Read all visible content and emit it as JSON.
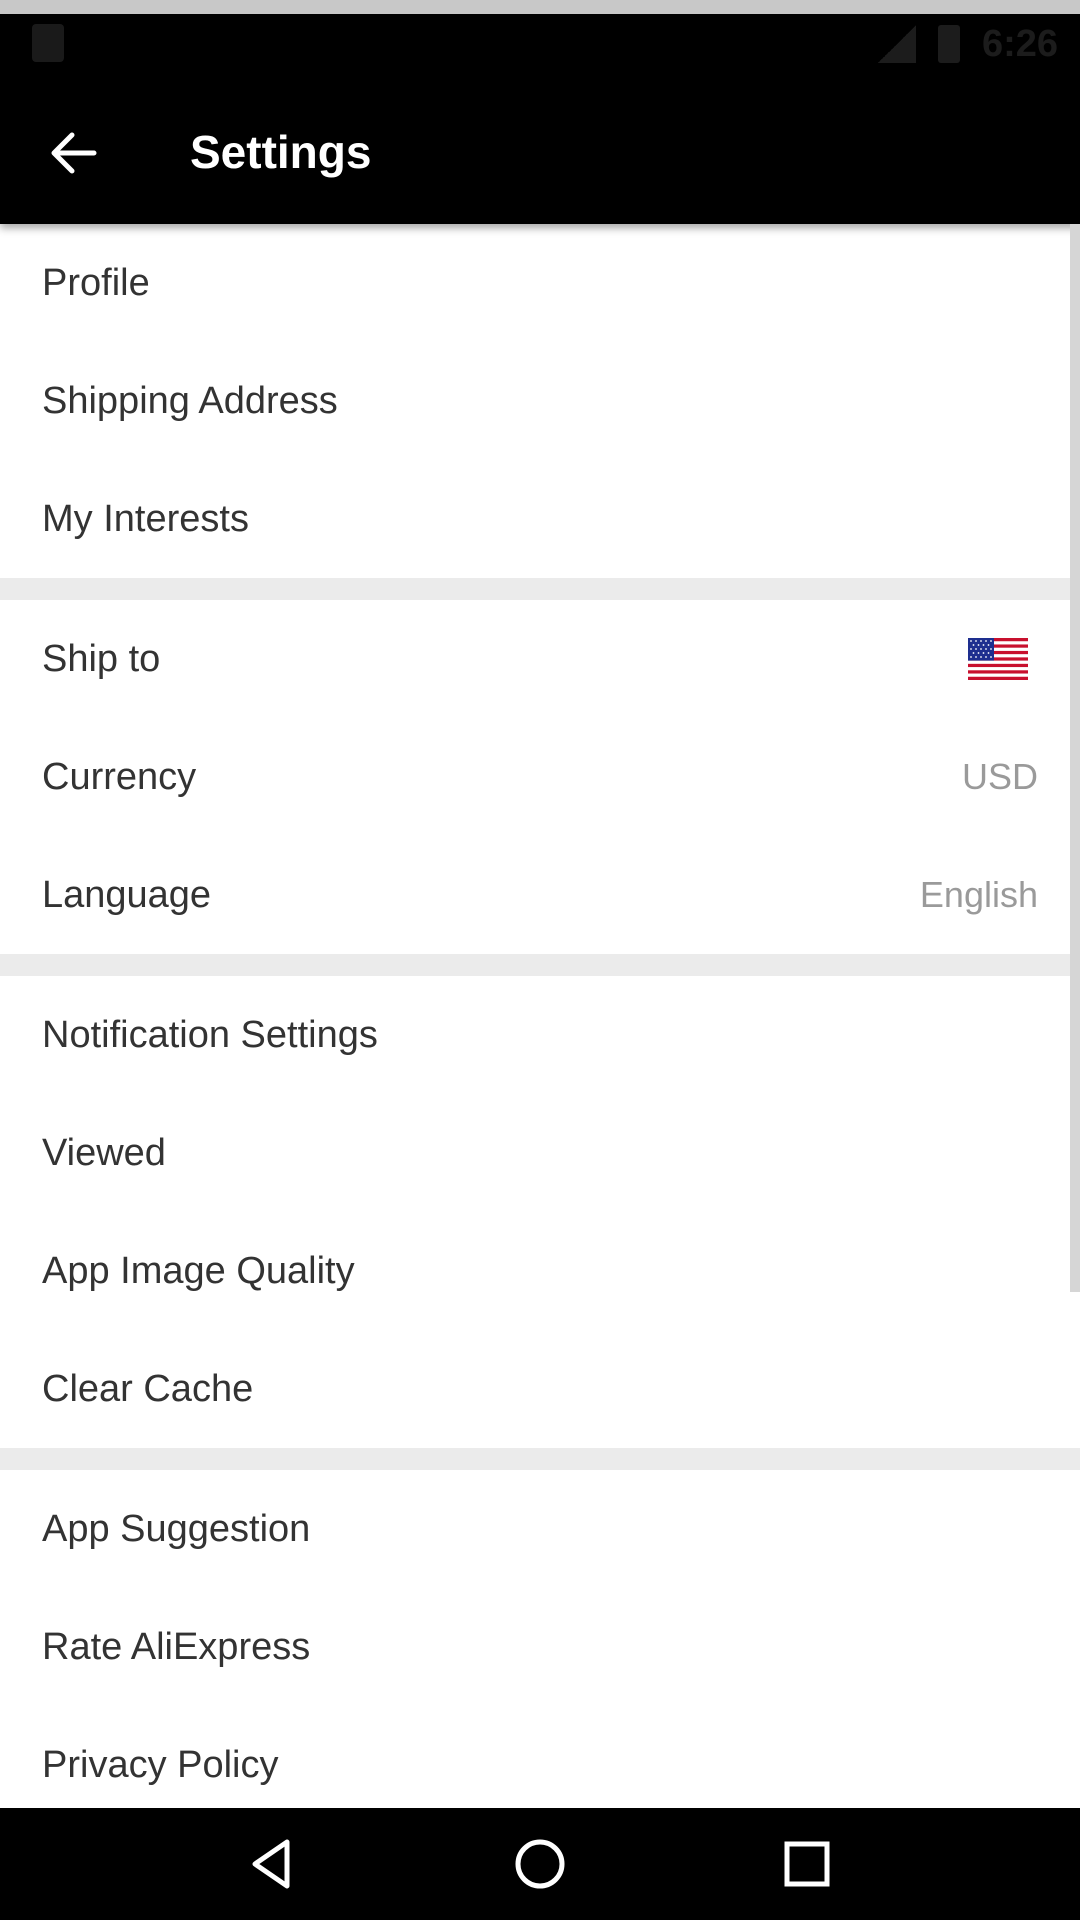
{
  "status_bar": {
    "time": "6:26",
    "icons": [
      "sd-card-icon",
      "signal-icon",
      "battery-icon"
    ]
  },
  "app_bar": {
    "back_icon": "arrow-left-icon",
    "title": "Settings"
  },
  "sections": [
    {
      "items": [
        {
          "label": "Profile"
        },
        {
          "label": "Shipping Address"
        },
        {
          "label": "My Interests"
        }
      ]
    },
    {
      "items": [
        {
          "label": "Ship to",
          "value_icon": "us-flag-icon"
        },
        {
          "label": "Currency",
          "value": "USD"
        },
        {
          "label": "Language",
          "value": "English"
        }
      ]
    },
    {
      "items": [
        {
          "label": "Notification Settings"
        },
        {
          "label": "Viewed"
        },
        {
          "label": "App Image Quality"
        },
        {
          "label": "Clear Cache"
        }
      ]
    },
    {
      "items": [
        {
          "label": "App Suggestion"
        },
        {
          "label": "Rate AliExpress"
        },
        {
          "label": "Privacy Policy"
        }
      ]
    }
  ],
  "nav_bar": {
    "icons": [
      "back-triangle-icon",
      "home-circle-icon",
      "recents-square-icon"
    ]
  },
  "colors": {
    "app_bar_bg": "#000000",
    "separator": "#ebebeb",
    "label_text": "#333333",
    "value_text": "#9a9a9a"
  }
}
